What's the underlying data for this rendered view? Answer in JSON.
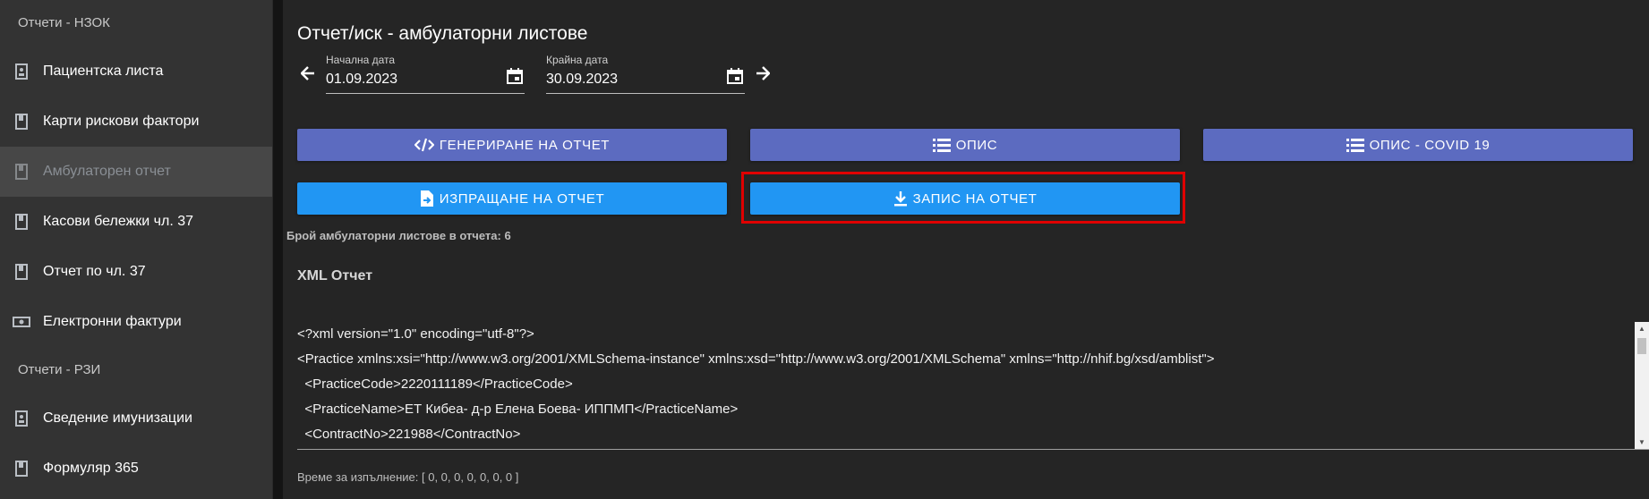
{
  "sidebar": {
    "section1_title": "Отчети - НЗОК",
    "section2_title": "Отчети - РЗИ",
    "items1": [
      {
        "label": "Пациентска листа",
        "icon": "contact-card-icon"
      },
      {
        "label": "Карти рискови фактори",
        "icon": "book-icon"
      },
      {
        "label": "Амбулаторен отчет",
        "icon": "book-icon"
      },
      {
        "label": "Касови бележки чл. 37",
        "icon": "book-icon"
      },
      {
        "label": "Отчет по чл. 37",
        "icon": "book-icon"
      },
      {
        "label": "Електронни фактури",
        "icon": "cash-icon"
      }
    ],
    "items2": [
      {
        "label": "Сведение имунизации",
        "icon": "contact-card-icon"
      },
      {
        "label": "Формуляр 365",
        "icon": "book-icon"
      }
    ]
  },
  "main": {
    "title": "Отчет/иск - амбулаторни листове",
    "start_date_label": "Начална дата",
    "start_date_value": "01.09.2023",
    "end_date_label": "Крайна дата",
    "end_date_value": "30.09.2023",
    "buttons": {
      "generate": "ГЕНЕРИРАНЕ НА ОТЧЕТ",
      "description": "ОПИС",
      "description_covid": "ОПИС - COVID 19",
      "send": "ИЗПРАЩАНЕ НА ОТЧЕТ",
      "save": "ЗАПИС НА ОТЧЕТ"
    },
    "count_text": "Брой амбулаторни листове в отчета: 6",
    "xml_title": "XML Отчет",
    "xml_lines": [
      "<?xml version=\"1.0\" encoding=\"utf-8\"?>",
      "<Practice xmlns:xsi=\"http://www.w3.org/2001/XMLSchema-instance\" xmlns:xsd=\"http://www.w3.org/2001/XMLSchema\" xmlns=\"http://nhif.bg/xsd/amblist\">",
      "  <PracticeCode>2220111189</PracticeCode>",
      "  <PracticeName>ЕТ Кибеа- д-р Елена Боева- ИППМП</PracticeName>",
      "  <ContractNo>221988</ContractNo>"
    ],
    "exec_time": "Време за изпълнение: [ 0, 0, 0, 0, 0, 0, 0 ]"
  },
  "colors": {
    "indigo": "#5c6bc0",
    "blue": "#2196f3",
    "highlight": "#e00000"
  }
}
